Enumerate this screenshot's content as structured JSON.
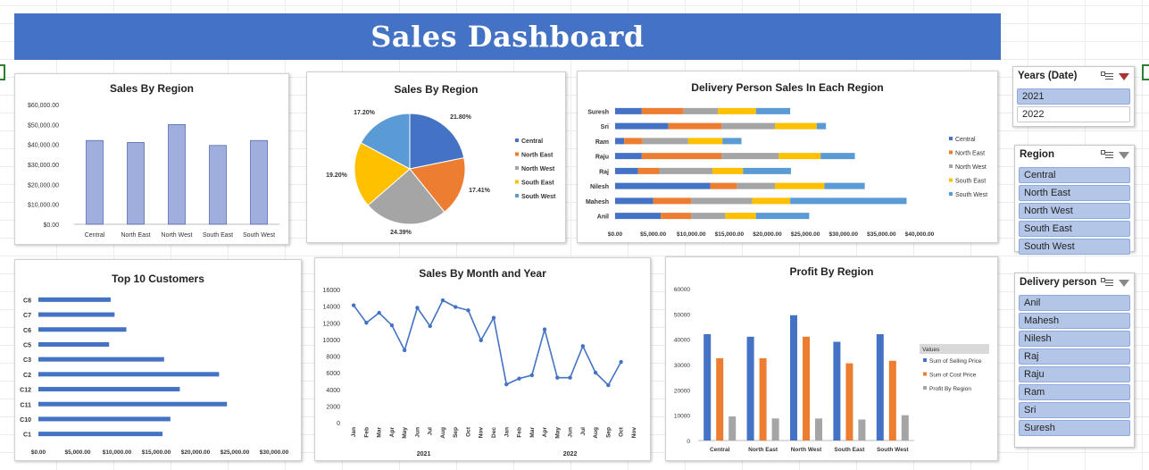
{
  "dashboard": {
    "title": "Sales Dashboard"
  },
  "colors": {
    "banner": "#4472c4",
    "blue": "#4472c4",
    "orange": "#ed7d31",
    "gray": "#a5a5a5",
    "yellow": "#ffc000",
    "lightblue": "#5b9bd5",
    "bar_fill": "#9faedc"
  },
  "charts": {
    "region_bar": {
      "type": "bar",
      "title": "Sales By Region",
      "categories": [
        "Central",
        "North East",
        "North West",
        "South East",
        "South West"
      ],
      "values": [
        42000,
        41000,
        50000,
        39500,
        42000
      ],
      "ylim": [
        0,
        60000
      ],
      "yticks": [
        "$0.00",
        "$10,000.00",
        "$20,000.00",
        "$30,000.00",
        "$40,000.00",
        "$50,000.00",
        "$60,000.00"
      ]
    },
    "region_pie": {
      "type": "pie",
      "title": "Sales By Region",
      "labels": [
        "Central",
        "North East",
        "North West",
        "South East",
        "South West"
      ],
      "values": [
        21.8,
        17.41,
        24.39,
        19.2,
        17.2
      ],
      "value_labels": [
        "21.80%",
        "17.41%",
        "24.39%",
        "19.20%",
        "17.20%"
      ],
      "legend": "right"
    },
    "delivery": {
      "type": "bar",
      "title": "Delivery Person Sales In Each Region",
      "categories": [
        "Suresh",
        "Sri",
        "Ram",
        "Raju",
        "Raj",
        "Nilesh",
        "Mahesh",
        "Anil"
      ],
      "series": [
        {
          "name": "Central",
          "values": [
            3500,
            7000,
            1200,
            3500,
            3000,
            12500,
            5000,
            6000
          ]
        },
        {
          "name": "North East",
          "values": [
            5500,
            7000,
            2400,
            10500,
            2800,
            3500,
            5000,
            4000
          ]
        },
        {
          "name": "North West",
          "values": [
            4500,
            7000,
            6000,
            7500,
            7000,
            5000,
            8000,
            4500
          ]
        },
        {
          "name": "South East",
          "values": [
            5000,
            5500,
            4500,
            5500,
            4000,
            6500,
            5000,
            4000
          ]
        },
        {
          "name": "South West",
          "values": [
            4500,
            1200,
            2500,
            4500,
            6300,
            5300,
            15300,
            7000
          ]
        }
      ],
      "xticks": [
        "$0.00",
        "$5,000.00",
        "$10,000.00",
        "$15,000.00",
        "$20,000.00",
        "$25,000.00",
        "$30,000.00",
        "$35,000.00",
        "$40,000.00"
      ],
      "xlim": [
        0,
        40000
      ],
      "legend": "right"
    },
    "customers": {
      "type": "bar",
      "title": "Top 10 Customers",
      "categories": [
        "C8",
        "C7",
        "C6",
        "C5",
        "C3",
        "C2",
        "C12",
        "C11",
        "C10",
        "C1"
      ],
      "values": [
        9200,
        9700,
        11200,
        9000,
        16000,
        23000,
        18000,
        24000,
        16800,
        15800
      ],
      "xticks": [
        "$0.00",
        "$5,000.00",
        "$10,000.00",
        "$15,000.00",
        "$20,000.00",
        "$25,000.00",
        "$30,000.00"
      ],
      "xlim": [
        0,
        30000
      ]
    },
    "monthly": {
      "type": "line",
      "title": "Sales By Month and Year",
      "months": [
        "Jan",
        "Feb",
        "Mar",
        "Apr",
        "May",
        "Jun",
        "Jul",
        "Aug",
        "Sep",
        "Oct",
        "Nov",
        "Dec",
        "Jan",
        "Feb",
        "Mar",
        "Apr",
        "May",
        "Jun",
        "Jul",
        "Aug",
        "Sep",
        "Oct",
        "Nov"
      ],
      "values": [
        14100,
        12000,
        13200,
        11700,
        8700,
        13800,
        11600,
        14700,
        13900,
        13500,
        9900,
        12600,
        4600,
        5300,
        5700,
        11200,
        5400,
        5400,
        9200,
        6000,
        4500,
        7300
      ],
      "years": [
        "2021",
        "2022"
      ],
      "ylim": [
        0,
        16000
      ],
      "yticks": [
        "0",
        "2000",
        "4000",
        "6000",
        "8000",
        "10000",
        "12000",
        "14000",
        "16000"
      ]
    },
    "profit": {
      "type": "bar",
      "title": "Profit By Region",
      "categories": [
        "Central",
        "North East",
        "North West",
        "South East",
        "South West"
      ],
      "series": [
        {
          "name": "Sum of Selling Price",
          "values": [
            42000,
            41000,
            49500,
            39000,
            42000
          ]
        },
        {
          "name": "Sum of Cost Price",
          "values": [
            32500,
            32500,
            41000,
            30500,
            31500
          ]
        },
        {
          "name": "Profit By Region",
          "values": [
            9500,
            8700,
            8700,
            8300,
            10000
          ]
        }
      ],
      "ylim": [
        0,
        60000
      ],
      "yticks": [
        "0",
        "10000",
        "20000",
        "30000",
        "40000",
        "50000",
        "60000"
      ],
      "legend_title": "Values"
    }
  },
  "slicers": {
    "years": {
      "title": "Years (Date)",
      "items": [
        "2021",
        "2022"
      ],
      "selected": [
        true,
        false
      ]
    },
    "region": {
      "title": "Region",
      "items": [
        "Central",
        "North East",
        "North West",
        "South East",
        "South West"
      ]
    },
    "delivery": {
      "title": "Delivery person",
      "items": [
        "Anil",
        "Mahesh",
        "Nilesh",
        "Raj",
        "Raju",
        "Ram",
        "Sri",
        "Suresh"
      ]
    }
  }
}
